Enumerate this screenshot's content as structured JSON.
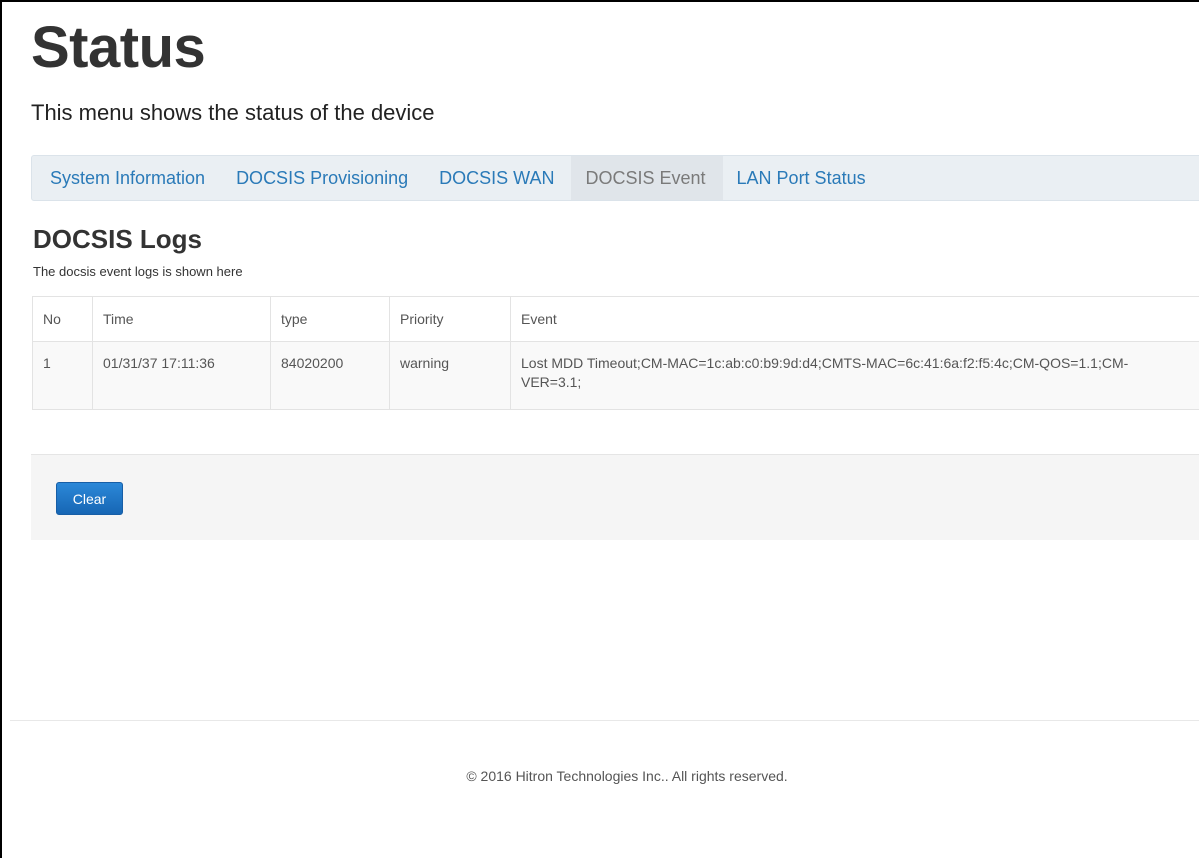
{
  "page": {
    "title": "Status",
    "subtitle": "This menu shows the status of the device"
  },
  "tabs": [
    {
      "label": "System Information",
      "active": false
    },
    {
      "label": "DOCSIS Provisioning",
      "active": false
    },
    {
      "label": "DOCSIS WAN",
      "active": false
    },
    {
      "label": "DOCSIS Event",
      "active": true
    },
    {
      "label": "LAN Port Status",
      "active": false
    }
  ],
  "section": {
    "title": "DOCSIS Logs",
    "description": "The docsis event logs is shown here"
  },
  "table": {
    "columns": [
      "No",
      "Time",
      "type",
      "Priority",
      "Event"
    ],
    "rows": [
      {
        "no": "1",
        "time": "01/31/37 17:11:36",
        "type": "84020200",
        "priority": "warning",
        "event": "Lost MDD Timeout;CM-MAC=1c:ab:c0:b9:9d:d4;CMTS-MAC=6c:41:6a:f2:f5:4c;CM-QOS=1.1;CM-VER=3.1;"
      }
    ]
  },
  "actions": {
    "clear_label": "Clear"
  },
  "footer": {
    "copyright": "© 2016 Hitron Technologies Inc.. All rights reserved."
  },
  "colors": {
    "link": "#2a7ab8",
    "active_tab_text": "#7a7a7a",
    "tab_bar_bg": "#eaeff3",
    "primary_button": "#1e6fc0"
  }
}
